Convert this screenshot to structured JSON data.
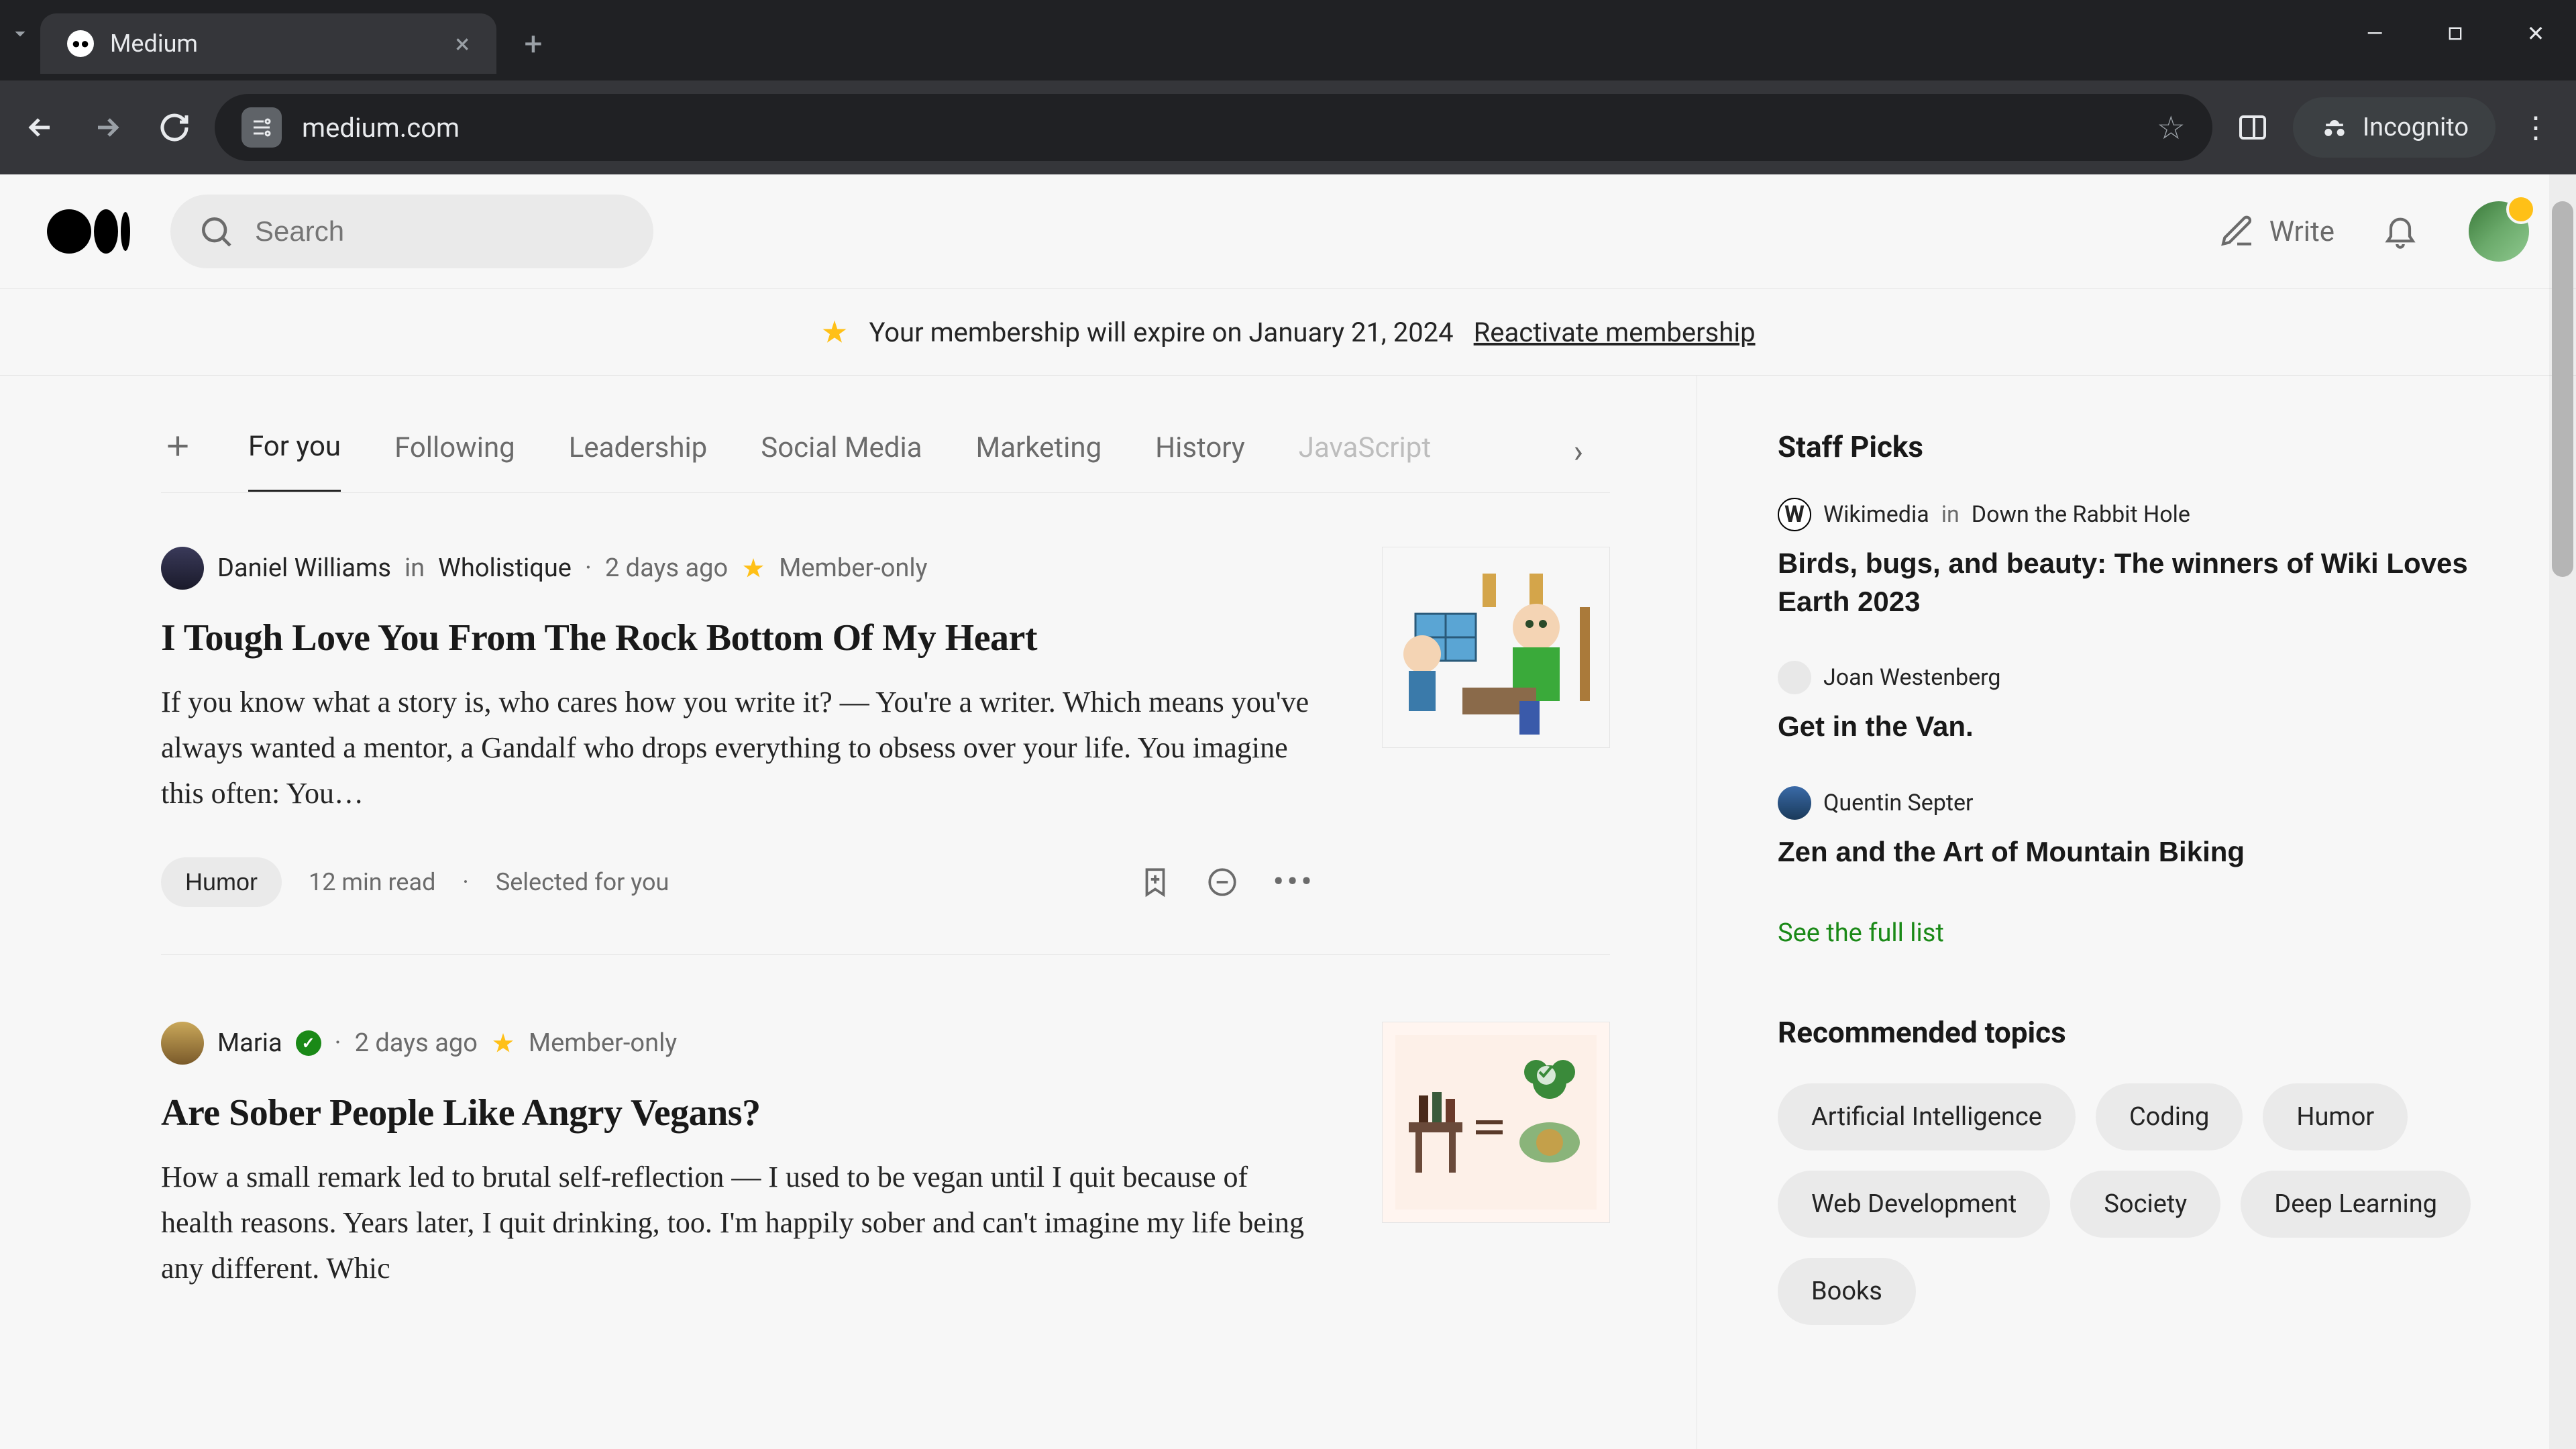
{
  "browser": {
    "tab_title": "Medium",
    "url": "medium.com",
    "incognito_label": "Incognito"
  },
  "header": {
    "search_placeholder": "Search",
    "write_label": "Write"
  },
  "banner": {
    "message": "Your membership will expire on January 21, 2024",
    "cta": "Reactivate membership"
  },
  "feed_tabs": [
    "For you",
    "Following",
    "Leadership",
    "Social Media",
    "Marketing",
    "History",
    "JavaScript"
  ],
  "articles": [
    {
      "author": "Daniel Williams",
      "in_word": "in",
      "publication": "Wholistique",
      "time": "2 days ago",
      "member_label": "Member-only",
      "title": "I Tough Love You From The Rock Bottom Of My Heart",
      "excerpt": "If you know what a story is, who cares how you write it? — You're a writer. Which means you've always wanted a mentor, a Gandalf who drops everything to obsess over your life. You imagine this often: You…",
      "tag": "Humor",
      "read_time": "12 min read",
      "selected": "Selected for you"
    },
    {
      "author": "Maria",
      "verified": true,
      "time": "2 days ago",
      "member_label": "Member-only",
      "title": "Are Sober People Like Angry Vegans?",
      "excerpt": "How a small remark led to brutal self-reflection — I used to be vegan until I quit because of health reasons. Years later, I quit drinking, too. I'm happily sober and can't imagine my life being any different. Whic"
    }
  ],
  "sidebar": {
    "staff_picks_heading": "Staff Picks",
    "picks": [
      {
        "author": "Wikimedia",
        "in_word": "in",
        "publication": "Down the Rabbit Hole",
        "title": "Birds, bugs, and beauty: The winners of Wiki Loves Earth 2023"
      },
      {
        "author": "Joan Westenberg",
        "title": "Get in the Van."
      },
      {
        "author": "Quentin Septer",
        "title": "Zen and the Art of Mountain Biking"
      }
    ],
    "see_all": "See the full list",
    "recommended_heading": "Recommended topics",
    "topics": [
      "Artificial Intelligence",
      "Coding",
      "Humor",
      "Web Development",
      "Society",
      "Deep Learning",
      "Books"
    ]
  }
}
